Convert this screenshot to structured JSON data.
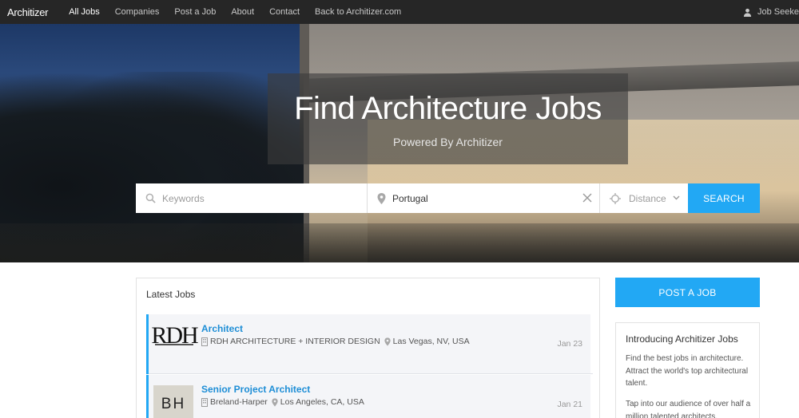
{
  "nav": {
    "logo": "Architizer",
    "links": [
      "All Jobs",
      "Companies",
      "Post a Job",
      "About",
      "Contact",
      "Back to Architizer.com"
    ],
    "active_index": 0,
    "user": "Job Seeke"
  },
  "hero": {
    "title": "Find Architecture Jobs",
    "subtitle": "Powered By Architizer"
  },
  "search": {
    "keywords_placeholder": "Keywords",
    "location_value": "Portugal",
    "distance_label": "Distance",
    "button": "SEARCH"
  },
  "latest": {
    "heading": "Latest Jobs",
    "jobs": [
      {
        "logo_text": "RDH",
        "title": "Architect",
        "company": "RDH ARCHITECTURE + INTERIOR DESIGN",
        "location": "Las Vegas, NV, USA",
        "date": "Jan 23"
      },
      {
        "logo_text": "BH",
        "title": "Senior Project Architect",
        "company": "Breland-Harper",
        "location": "Los Angeles, CA, USA",
        "date": "Jan 21"
      }
    ]
  },
  "sidebar": {
    "post_button": "POST A JOB",
    "intro_title": "Introducing Architizer Jobs",
    "intro_text": "Find the best jobs in architecture. Attract the world's top architectural talent.",
    "intro_text2": "Tap into our audience of over half a million talented architects."
  },
  "colors": {
    "accent": "#22a8f4",
    "nav_bg": "#262626",
    "link_blue": "#1e8ed6"
  }
}
